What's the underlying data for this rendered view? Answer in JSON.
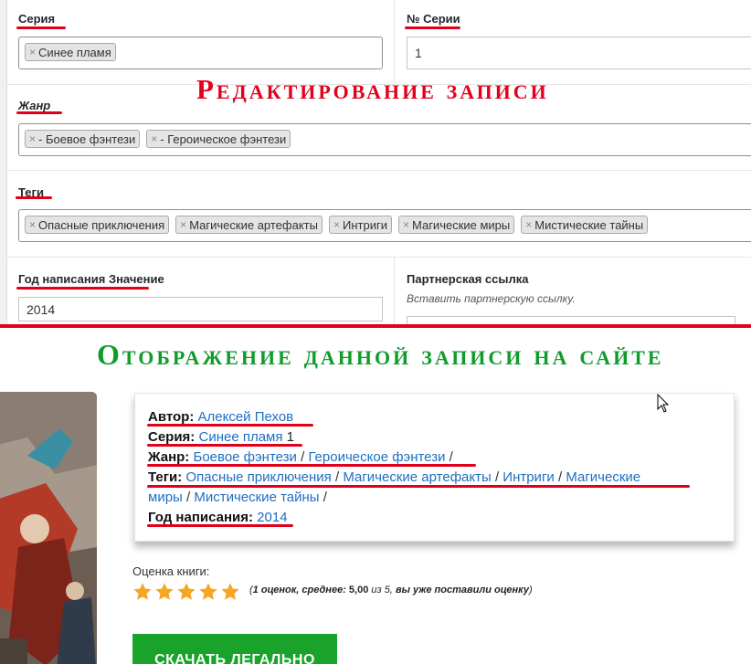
{
  "admin": {
    "headline": "Редактирование записи",
    "series": {
      "label": "Серия",
      "tags": [
        "Синее пламя"
      ]
    },
    "series_number": {
      "label": "№ Серии",
      "value": "1"
    },
    "genre": {
      "label": "Жанр",
      "tags": [
        "- Боевое фэнтези",
        "- Героическое фэнтези"
      ]
    },
    "tags": {
      "label": "Теги",
      "tags": [
        "Опасные приключения",
        "Магические артефакты",
        "Интриги",
        "Магические миры",
        "Мистические тайны"
      ]
    },
    "year": {
      "label": "Год написания Значение",
      "value": "2014"
    },
    "partner_link": {
      "label": "Партнерская ссылка",
      "hint": "Вставить партнерскую ссылку.",
      "value": ""
    },
    "remove_glyph": "×"
  },
  "front": {
    "headline": "Отображение данной записи на сайте",
    "info": {
      "author_label": "Автор:",
      "author": "Алексей Пехов",
      "series_label": "Серия:",
      "series": "Синее пламя",
      "series_number": "1",
      "genre_label": "Жанр:",
      "genres": [
        "Боевое фэнтези",
        "Героическое фэнтези"
      ],
      "tags_label": "Теги:",
      "tags": [
        "Опасные приключения",
        "Магические артефакты",
        "Интриги",
        "Магические",
        "миры",
        "Мистические тайны"
      ],
      "year_label": "Год написания:",
      "year": "2014",
      "separator": "/"
    },
    "rating": {
      "label": "Оценка книги:",
      "stars_filled": 5,
      "stars_total": 5,
      "text_open": "(",
      "count": "1 оценок, среднее:",
      "avg": "5,00",
      "of": "из 5,",
      "voted": "вы уже поставили оценку",
      "text_close": ")"
    },
    "download_button": "СКАЧАТЬ ЛЕГАЛЬНО"
  },
  "colors": {
    "underline_red": "#e0001a",
    "headline_green": "#0f9c2b",
    "link_blue": "#1e6fc2",
    "star_orange": "#f5a623",
    "button_green": "#1aa32a"
  }
}
